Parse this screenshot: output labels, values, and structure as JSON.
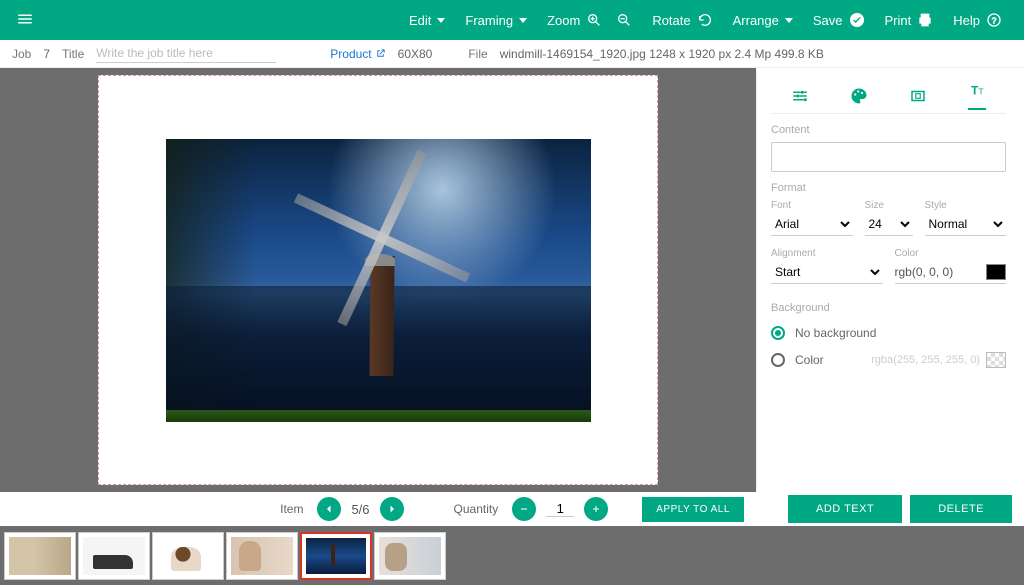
{
  "toolbar": {
    "edit": "Edit",
    "framing": "Framing",
    "zoom": "Zoom",
    "rotate": "Rotate",
    "arrange": "Arrange",
    "save": "Save",
    "print": "Print",
    "help": "Help"
  },
  "meta": {
    "job_label": "Job",
    "job_num": "7",
    "title_label": "Title",
    "title_placeholder": "Write the job title here",
    "product_label": "Product",
    "product_size": "60X80",
    "file_label": "File",
    "file_info": "windmill-1469154_1920.jpg 1248 x 1920 px 2.4 Mp 499.8 KB"
  },
  "panel": {
    "content_label": "Content",
    "format_label": "Format",
    "font_label": "Font",
    "font_value": "Arial",
    "size_label": "Size",
    "size_value": "24",
    "style_label": "Style",
    "style_value": "Normal",
    "alignment_label": "Alignment",
    "alignment_value": "Start",
    "color_label": "Color",
    "color_value": "rgb(0, 0, 0)",
    "background_label": "Background",
    "bg_none": "No background",
    "bg_color": "Color",
    "bg_color_value": "rgba(255, 255, 255, 0)"
  },
  "bottom": {
    "item_label": "Item",
    "item_pos": "5/6",
    "qty_label": "Quantity",
    "qty_value": "1",
    "apply": "APPLY TO ALL",
    "add_text": "ADD TEXT",
    "delete": "DELETE"
  }
}
